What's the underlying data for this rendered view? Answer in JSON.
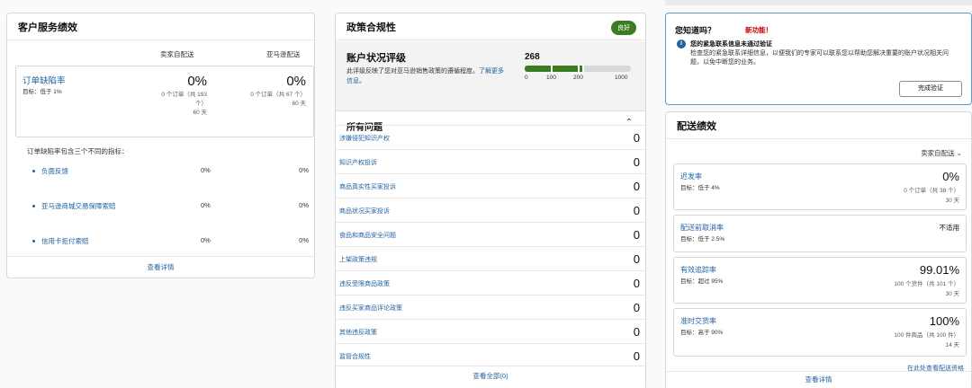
{
  "customer_service": {
    "title": "客户服务绩效",
    "col_merchant": "卖家自配送",
    "col_amazon": "亚马逊配送",
    "odr": {
      "name": "订单缺陷率",
      "target": "目标：低于 1%",
      "merchant_value": "0%",
      "merchant_sub1": "0 个订单（共 193",
      "merchant_sub2": "个）",
      "merchant_sub3": "60 天",
      "amazon_value": "0%",
      "amazon_sub1": "0 个订单（共 67 个）",
      "amazon_sub2": "60 天"
    },
    "note": "订单缺陷率包含三个不同的指标：",
    "sub_metrics": [
      {
        "label": "负面反馈",
        "merchant": "0%",
        "amazon": "0%"
      },
      {
        "label": "亚马逊商城交易保障索赔",
        "merchant": "0%",
        "amazon": "0%"
      },
      {
        "label": "信用卡拒付索赔",
        "merchant": "0%",
        "amazon": "0%"
      }
    ],
    "footer": "查看详情"
  },
  "policy": {
    "title": "政策合规性",
    "badge": "良好",
    "ahr_title": "账户状况评级",
    "ahr_desc": "此评级反映了您对亚马逊销售政策的遵循程度。",
    "ahr_link": "了解更多信息。",
    "score": "268",
    "score_value": 268,
    "ticks": [
      "0",
      "100",
      "200",
      "1000"
    ],
    "issues_title": "所有问题",
    "issues": [
      {
        "label": "涉嫌侵犯知识产权",
        "value": "0"
      },
      {
        "label": "知识产权投诉",
        "value": "0"
      },
      {
        "label": "商品真实性买家投诉",
        "value": "0"
      },
      {
        "label": "商品状况买家投诉",
        "value": "0"
      },
      {
        "label": "食品和商品安全问题",
        "value": "0"
      },
      {
        "label": "上架政策违规",
        "value": "0"
      },
      {
        "label": "违反受限商品政策",
        "value": "0"
      },
      {
        "label": "违反买家商品评论政策",
        "value": "0"
      },
      {
        "label": "其他违反政策",
        "value": "0"
      },
      {
        "label": "监管合规性",
        "value": "0"
      }
    ],
    "footer": "查看全部(0)"
  },
  "notice": {
    "title": "您知道吗？",
    "new_label": "新功能！",
    "headline": "您的紧急联系信息未通过验证",
    "body": "检查您的紧急联系详细信息，以便我们的专家可以联系您以帮助您解决重要的账户状况相关问题，以免中断您的业务。",
    "button": "完成验证"
  },
  "delivery": {
    "title": "配送绩效",
    "selector": "卖家自配送",
    "metrics": [
      {
        "name": "迟发率",
        "target": "目标：低于 4%",
        "value": "0%",
        "sub1": "0 个订单（共 38 个）",
        "sub2": "30 天"
      },
      {
        "name": "配送前取消率",
        "target": "目标：低于 2.5%",
        "value": "不适用",
        "sub1": "",
        "sub2": ""
      },
      {
        "name": "有效追踪率",
        "target": "目标：超过 95%",
        "value": "99.01%",
        "sub1": "100 个货件（共 101 个）",
        "sub2": "30 天"
      },
      {
        "name": "准时交货率",
        "target": "目标：高于 90%",
        "value": "100%",
        "sub1": "100 件商品（共 100 件）",
        "sub2": "14 天"
      }
    ],
    "link": "在此处查看配送资格",
    "footer": "查看详情"
  }
}
